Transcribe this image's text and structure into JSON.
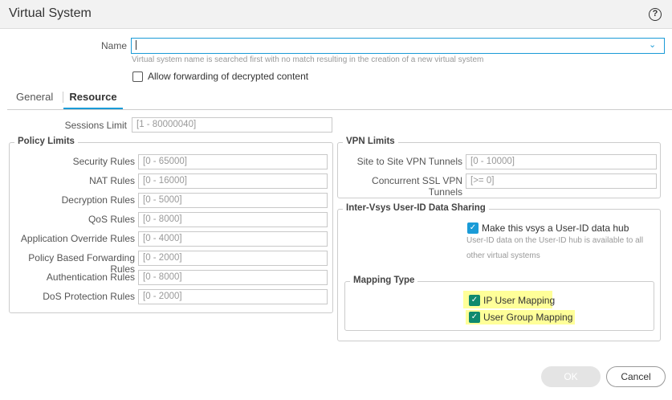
{
  "dialog": {
    "title": "Virtual System",
    "help_icon": "?"
  },
  "name": {
    "label": "Name",
    "value": "",
    "help": "Virtual system name is searched first with no match resulting in the creation of a new virtual system"
  },
  "allow_forwarding": {
    "label": "Allow forwarding of decrypted content",
    "checked": false
  },
  "tabs": [
    {
      "label": "General"
    },
    {
      "label": "Resource",
      "active": true
    }
  ],
  "sessions": {
    "label": "Sessions Limit",
    "placeholder": "[1 - 80000040]"
  },
  "policy": {
    "title": "Policy Limits",
    "rows": [
      {
        "label": "Security Rules",
        "placeholder": "[0 - 65000]"
      },
      {
        "label": "NAT Rules",
        "placeholder": "[0 - 16000]"
      },
      {
        "label": "Decryption Rules",
        "placeholder": "[0 - 5000]"
      },
      {
        "label": "QoS Rules",
        "placeholder": "[0 - 8000]"
      },
      {
        "label": "Application Override Rules",
        "placeholder": "[0 - 4000]"
      },
      {
        "label": "Policy Based Forwarding Rules",
        "placeholder": "[0 - 2000]"
      },
      {
        "label": "Authentication Rules",
        "placeholder": "[0 - 8000]"
      },
      {
        "label": "DoS Protection Rules",
        "placeholder": "[0 - 2000]"
      }
    ]
  },
  "vpn": {
    "title": "VPN Limits",
    "rows": [
      {
        "label": "Site to Site VPN Tunnels",
        "placeholder": "[0 - 10000]"
      },
      {
        "label": "Concurrent SSL VPN Tunnels",
        "placeholder": "[>= 0]"
      }
    ]
  },
  "intervsys": {
    "title": "Inter-Vsys User-ID Data Sharing",
    "hub_label": "Make this vsys a User-ID data hub",
    "hub_help1": "User-ID data on the User-ID hub is available to all",
    "hub_help2": "other virtual systems",
    "mapping": {
      "title": "Mapping Type",
      "items": [
        {
          "label": "IP User Mapping",
          "checked": true
        },
        {
          "label": "User Group Mapping",
          "checked": true
        }
      ]
    }
  },
  "buttons": {
    "ok": "OK",
    "cancel": "Cancel"
  },
  "colors": {
    "accent": "#1a9bd7",
    "check": "#0f8a6e",
    "highlight": "#ffff99"
  }
}
